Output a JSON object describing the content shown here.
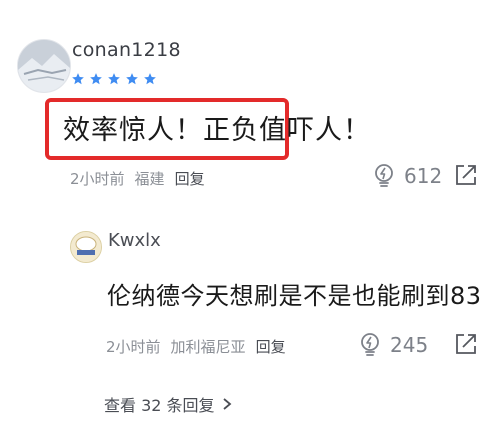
{
  "comment": {
    "username": "conan1218",
    "rating": 5,
    "text": "效率惊人！正负值吓人！",
    "time": "2小时前",
    "location": "福建",
    "reply_label": "回复",
    "likes": "612",
    "highlight_color": "#e32a2a",
    "star_color": "#3f8cf2"
  },
  "reply": {
    "username": "Kwxlx",
    "text": "伦纳德今天想刷是不是也能刷到83",
    "time": "2小时前",
    "location": "加利福尼亚",
    "reply_label": "回复",
    "likes": "245"
  },
  "view_more": {
    "label": "查看 32 条回复",
    "icon": "chevron-right-icon"
  }
}
